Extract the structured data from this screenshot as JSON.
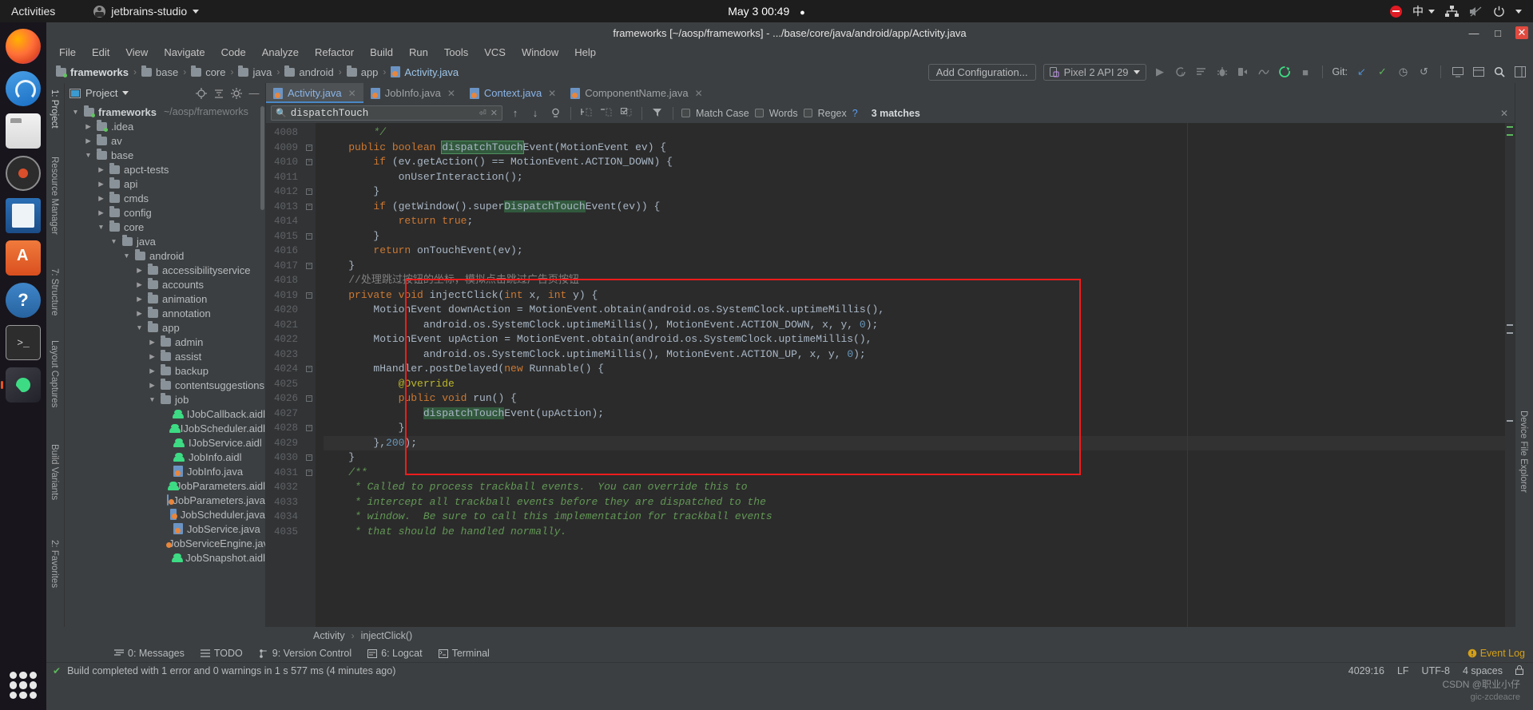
{
  "desktop": {
    "activities": "Activities",
    "app_name": "jetbrains-studio",
    "clock": "May 3  00:49",
    "icons": {
      "record": "record-stop-icon",
      "input_method": "中",
      "network": "network-icon",
      "volume": "volume-muted-icon",
      "power": "power-icon"
    },
    "dock": [
      {
        "name": "firefox",
        "label": "Firefox"
      },
      {
        "name": "thunderbird",
        "label": "Thunderbird"
      },
      {
        "name": "files",
        "label": "Files"
      },
      {
        "name": "rhythmbox",
        "label": "Rhythmbox"
      },
      {
        "name": "libreoffice-writer",
        "label": "LibreOffice Writer"
      },
      {
        "name": "ubuntu-software",
        "label": "Ubuntu Software"
      },
      {
        "name": "help",
        "label": "Help"
      },
      {
        "name": "terminal",
        "label": "Terminal"
      },
      {
        "name": "android-studio",
        "label": "Android Studio"
      }
    ]
  },
  "window": {
    "title": "frameworks [~/aosp/frameworks] - .../base/core/java/android/app/Activity.java",
    "buttons": {
      "minimize": "—",
      "maximize": "□",
      "close": "✕"
    }
  },
  "menubar": [
    "File",
    "Edit",
    "View",
    "Navigate",
    "Code",
    "Analyze",
    "Refactor",
    "Build",
    "Run",
    "Tools",
    "VCS",
    "Window",
    "Help"
  ],
  "navbar": {
    "breadcrumbs": [
      {
        "label": "frameworks",
        "icon": "module-icon",
        "bold": true
      },
      {
        "label": "base",
        "icon": "folder-icon",
        "bold": false
      },
      {
        "label": "core",
        "icon": "folder-icon",
        "bold": false
      },
      {
        "label": "java",
        "icon": "folder-icon",
        "bold": false
      },
      {
        "label": "android",
        "icon": "folder-icon",
        "bold": false
      },
      {
        "label": "app",
        "icon": "folder-icon",
        "bold": false
      },
      {
        "label": "Activity.java",
        "icon": "java-file-icon",
        "bold": false
      }
    ],
    "add_configuration": "Add Configuration...",
    "device": "Pixel 2 API 29",
    "git_label": "Git:",
    "toolbar_icons": [
      "run-icon",
      "debug-attach-icon",
      "coverage-icon",
      "profile-bug-icon",
      "attach-debugger-icon",
      "profiler-icon",
      "sync-gradle-icon",
      "stop-icon"
    ],
    "git_icons": [
      "git-update-icon",
      "git-commit-icon",
      "git-history-icon",
      "git-rollback-icon"
    ],
    "right_icons": [
      "device-manager-icon",
      "sdk-manager-icon",
      "search-icon",
      "layout-icon"
    ]
  },
  "project_panel": {
    "title": "Project",
    "header_icons": [
      "locate-icon",
      "collapse-all-icon",
      "settings-gear-icon",
      "hide-icon"
    ],
    "left_tabs": [
      "1: Project",
      "Resource Manager",
      "7: Structure",
      "Layout Captures",
      "Build Variants",
      "2: Favorites"
    ],
    "tree": [
      {
        "label": "frameworks",
        "path": "~/aosp/frameworks",
        "indent": 0,
        "arrow": "▼",
        "icon": "module-icon",
        "bold": true
      },
      {
        "label": ".idea",
        "indent": 1,
        "arrow": "▶",
        "icon": "module-icon",
        "bold": false
      },
      {
        "label": "av",
        "indent": 1,
        "arrow": "▶",
        "icon": "folder-icon",
        "bold": false
      },
      {
        "label": "base",
        "indent": 1,
        "arrow": "▼",
        "icon": "folder-icon",
        "bold": false
      },
      {
        "label": "apct-tests",
        "indent": 2,
        "arrow": "▶",
        "icon": "folder-icon",
        "bold": false
      },
      {
        "label": "api",
        "indent": 2,
        "arrow": "▶",
        "icon": "folder-icon",
        "bold": false
      },
      {
        "label": "cmds",
        "indent": 2,
        "arrow": "▶",
        "icon": "folder-icon",
        "bold": false
      },
      {
        "label": "config",
        "indent": 2,
        "arrow": "▶",
        "icon": "folder-icon",
        "bold": false
      },
      {
        "label": "core",
        "indent": 2,
        "arrow": "▼",
        "icon": "folder-icon",
        "bold": false
      },
      {
        "label": "java",
        "indent": 3,
        "arrow": "▼",
        "icon": "folder-icon",
        "bold": false
      },
      {
        "label": "android",
        "indent": 4,
        "arrow": "▼",
        "icon": "folder-icon",
        "bold": false
      },
      {
        "label": "accessibilityservice",
        "indent": 5,
        "arrow": "▶",
        "icon": "folder-icon",
        "bold": false
      },
      {
        "label": "accounts",
        "indent": 5,
        "arrow": "▶",
        "icon": "folder-icon",
        "bold": false
      },
      {
        "label": "animation",
        "indent": 5,
        "arrow": "▶",
        "icon": "folder-icon",
        "bold": false
      },
      {
        "label": "annotation",
        "indent": 5,
        "arrow": "▶",
        "icon": "folder-icon",
        "bold": false
      },
      {
        "label": "app",
        "indent": 5,
        "arrow": "▼",
        "icon": "folder-icon",
        "bold": false
      },
      {
        "label": "admin",
        "indent": 6,
        "arrow": "▶",
        "icon": "folder-icon",
        "bold": false
      },
      {
        "label": "assist",
        "indent": 6,
        "arrow": "▶",
        "icon": "folder-icon",
        "bold": false
      },
      {
        "label": "backup",
        "indent": 6,
        "arrow": "▶",
        "icon": "folder-icon",
        "bold": false
      },
      {
        "label": "contentsuggestions",
        "indent": 6,
        "arrow": "▶",
        "icon": "folder-icon",
        "bold": false
      },
      {
        "label": "job",
        "indent": 6,
        "arrow": "▼",
        "icon": "folder-icon",
        "bold": false
      },
      {
        "label": "IJobCallback.aidl",
        "indent": 7,
        "arrow": "",
        "icon": "aidl-icon",
        "bold": false
      },
      {
        "label": "IJobScheduler.aidl",
        "indent": 7,
        "arrow": "",
        "icon": "aidl-icon",
        "bold": false
      },
      {
        "label": "IJobService.aidl",
        "indent": 7,
        "arrow": "",
        "icon": "aidl-icon",
        "bold": false
      },
      {
        "label": "JobInfo.aidl",
        "indent": 7,
        "arrow": "",
        "icon": "aidl-icon",
        "bold": false
      },
      {
        "label": "JobInfo.java",
        "indent": 7,
        "arrow": "",
        "icon": "java-file-icon",
        "bold": false
      },
      {
        "label": "JobParameters.aidl",
        "indent": 7,
        "arrow": "",
        "icon": "aidl-icon",
        "bold": false
      },
      {
        "label": "JobParameters.java",
        "indent": 7,
        "arrow": "",
        "icon": "java-file-icon",
        "bold": false
      },
      {
        "label": "JobScheduler.java",
        "indent": 7,
        "arrow": "",
        "icon": "java-file-icon",
        "bold": false
      },
      {
        "label": "JobService.java",
        "indent": 7,
        "arrow": "",
        "icon": "java-file-icon",
        "bold": false
      },
      {
        "label": "JobServiceEngine.java",
        "indent": 7,
        "arrow": "",
        "icon": "java-file-icon",
        "bold": false
      },
      {
        "label": "JobSnapshot.aidl",
        "indent": 7,
        "arrow": "",
        "icon": "aidl-icon",
        "bold": false
      }
    ]
  },
  "editor": {
    "tabs": [
      {
        "label": "Activity.java",
        "icon": "java-file-icon",
        "active": true
      },
      {
        "label": "JobInfo.java",
        "icon": "java-file-icon",
        "active": false
      },
      {
        "label": "Context.java",
        "icon": "java-file-icon",
        "active": false
      },
      {
        "label": "ComponentName.java",
        "icon": "java-file-icon",
        "active": false
      }
    ],
    "find": {
      "value": "dispatchTouch",
      "placeholder": "Search",
      "match_case_label": "Match Case",
      "words_label": "Words",
      "regex_label": "Regex",
      "help": "?",
      "matches": "3 matches",
      "icons": [
        "prev-match-icon",
        "next-match-icon",
        "select-all-occurrences-icon",
        "add-selection-icon",
        "remove-selection-icon",
        "select-all-icon",
        "filter-icon",
        "close-icon"
      ]
    },
    "first_line_number": 4008,
    "lines": [
      {
        "n": 4008,
        "fold": false,
        "html": "        <span class=\"cmt\">*/</span>"
      },
      {
        "n": 4009,
        "fold": true,
        "html": "    <span class=\"kw\">public boolean</span> <span class=\"hl-cur\">dispatchTouch</span>Event(MotionEvent ev) {"
      },
      {
        "n": 4010,
        "fold": true,
        "html": "        <span class=\"kw\">if</span> (ev.getAction() == MotionEvent.ACTION_DOWN) {"
      },
      {
        "n": 4011,
        "fold": false,
        "html": "            onUserInteraction();"
      },
      {
        "n": 4012,
        "fold": true,
        "html": "        }"
      },
      {
        "n": 4013,
        "fold": true,
        "html": "        <span class=\"kw\">if</span> (getWindow().super<span class=\"hl\">DispatchTouch</span>Event(ev)) {"
      },
      {
        "n": 4014,
        "fold": false,
        "html": "            <span class=\"kw\">return true</span>;"
      },
      {
        "n": 4015,
        "fold": true,
        "html": "        }"
      },
      {
        "n": 4016,
        "fold": false,
        "html": "        <span class=\"kw\">return</span> onTouchEvent(ev);"
      },
      {
        "n": 4017,
        "fold": true,
        "html": "    }"
      },
      {
        "n": 4018,
        "fold": false,
        "html": "    <span class=\"cmt2\">//处理跳过按钮的坐标，模拟点击跳过广告页按钮</span>"
      },
      {
        "n": 4019,
        "fold": true,
        "html": "    <span class=\"kw\">private void</span> injectClick(<span class=\"kw\">int</span> x, <span class=\"kw\">int</span> y) {"
      },
      {
        "n": 4020,
        "fold": false,
        "html": "        MotionEvent downAction = MotionEvent.obtain(android.os.SystemClock.uptimeMillis(),"
      },
      {
        "n": 4021,
        "fold": false,
        "html": "                android.os.SystemClock.uptimeMillis(), MotionEvent.ACTION_DOWN, x, y, <span class=\"num\">0</span>);"
      },
      {
        "n": 4022,
        "fold": false,
        "html": "        MotionEvent upAction = MotionEvent.obtain(android.os.SystemClock.uptimeMillis(),"
      },
      {
        "n": 4023,
        "fold": false,
        "html": "                android.os.SystemClock.uptimeMillis(), MotionEvent.ACTION_UP, x, y, <span class=\"num\">0</span>);"
      },
      {
        "n": 4024,
        "fold": true,
        "html": "        mHandler.postDelayed(<span class=\"kw\">new</span> Runnable() {"
      },
      {
        "n": 4025,
        "fold": false,
        "html": "            <span class=\"an\">@Override</span>"
      },
      {
        "n": 4026,
        "fold": true,
        "html": "            <span class=\"kw\">public void</span> run() {"
      },
      {
        "n": 4027,
        "fold": false,
        "html": "                <span class=\"hl\">dispatchTouch</span>Event(upAction);"
      },
      {
        "n": 4028,
        "fold": true,
        "html": "            }"
      },
      {
        "n": 4029,
        "fold": false,
        "html": "        },<span class=\"num\">200</span>);",
        "current": true
      },
      {
        "n": 4030,
        "fold": true,
        "html": "    }"
      },
      {
        "n": 4031,
        "fold": true,
        "html": "    <span class=\"cmt\">/**</span>"
      },
      {
        "n": 4032,
        "fold": false,
        "html": "     <span class=\"cmt\">* Called to process trackball events.  You can override this to</span>"
      },
      {
        "n": 4033,
        "fold": false,
        "html": "     <span class=\"cmt\">* intercept all trackball events before they are dispatched to the</span>"
      },
      {
        "n": 4034,
        "fold": false,
        "html": "     <span class=\"cmt\">* window.  Be sure to call this implementation for trackball events</span>"
      },
      {
        "n": 4035,
        "fold": false,
        "html": "     <span class=\"cmt\">* that should be handled normally.</span>"
      }
    ],
    "highlight_box_color": "#f01c1c",
    "breadcrumb": [
      "Activity",
      "injectClick()"
    ],
    "right_tabs": [
      "Device File Explorer"
    ]
  },
  "bottom_tools": [
    {
      "label": "0: Messages",
      "icon": "messages-icon"
    },
    {
      "label": "TODO",
      "icon": "todo-icon"
    },
    {
      "label": "9: Version Control",
      "icon": "vcs-icon"
    },
    {
      "label": "6: Logcat",
      "icon": "logcat-icon"
    },
    {
      "label": "Terminal",
      "icon": "terminal-icon"
    }
  ],
  "event_log": "Event Log",
  "statusbar": {
    "build_icon": "build-success-icon",
    "message": "Build completed with 1 error and 0 warnings in 1 s 577 ms (4 minutes ago)",
    "caret": "4029:16",
    "line_sep": "LF",
    "encoding": "UTF-8",
    "indent": "4 spaces",
    "lock_icon": "lock-icon"
  },
  "watermark": {
    "line1": "CSDN @职业小仔",
    "line2": "gic-zcdeacre"
  }
}
